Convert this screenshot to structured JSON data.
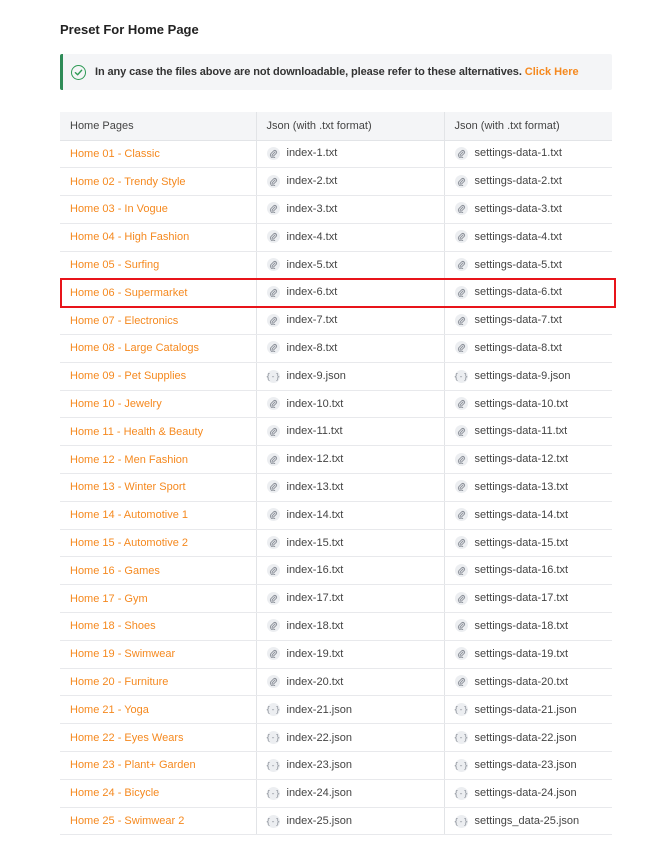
{
  "page": {
    "heading": "Preset For Home Page"
  },
  "callout": {
    "message": "In any case the files above are not downloadable, please refer to these alternatives.",
    "link_label": "Click Here",
    "accent_color": "#2e8b57",
    "link_color": "#f5891f"
  },
  "table": {
    "headers": [
      "Home Pages",
      "Json (with .txt format)",
      "Json (with .txt format)"
    ],
    "highlighted_row": 5,
    "rows": [
      {
        "name": "Home 01 - Classic",
        "index": "index-1.txt",
        "settings": "settings-data-1.txt",
        "icon": "paperclip-icon"
      },
      {
        "name": "Home 02 - Trendy Style",
        "index": "index-2.txt",
        "settings": "settings-data-2.txt",
        "icon": "paperclip-icon"
      },
      {
        "name": "Home 03 - In Vogue",
        "index": "index-3.txt",
        "settings": "settings-data-3.txt",
        "icon": "paperclip-icon"
      },
      {
        "name": "Home 04 - High Fashion",
        "index": "index-4.txt",
        "settings": "settings-data-4.txt",
        "icon": "paperclip-icon"
      },
      {
        "name": "Home 05 - Surfing",
        "index": "index-5.txt",
        "settings": "settings-data-5.txt",
        "icon": "paperclip-icon"
      },
      {
        "name": "Home 06 - Supermarket",
        "index": "index-6.txt",
        "settings": "settings-data-6.txt",
        "icon": "paperclip-icon"
      },
      {
        "name": "Home 07 - Electronics",
        "index": "index-7.txt",
        "settings": "settings-data-7.txt",
        "icon": "paperclip-icon"
      },
      {
        "name": "Home 08 - Large Catalogs",
        "index": "index-8.txt",
        "settings": "settings-data-8.txt",
        "icon": "paperclip-icon"
      },
      {
        "name": "Home 09 - Pet Supplies",
        "index": "index-9.json",
        "settings": "settings-data-9.json",
        "icon": "json-braces-icon"
      },
      {
        "name": "Home 10 - Jewelry",
        "index": "index-10.txt",
        "settings": "settings-data-10.txt",
        "icon": "paperclip-icon"
      },
      {
        "name": "Home 11 - Health & Beauty",
        "index": "index-11.txt",
        "settings": "settings-data-11.txt",
        "icon": "paperclip-icon"
      },
      {
        "name": "Home 12 - Men Fashion",
        "index": "index-12.txt",
        "settings": "settings-data-12.txt",
        "icon": "paperclip-icon"
      },
      {
        "name": "Home 13 - Winter Sport",
        "index": "index-13.txt",
        "settings": "settings-data-13.txt",
        "icon": "paperclip-icon"
      },
      {
        "name": "Home 14 - Automotive 1",
        "index": "index-14.txt",
        "settings": "settings-data-14.txt",
        "icon": "paperclip-icon"
      },
      {
        "name": "Home 15 - Automotive 2",
        "index": "index-15.txt",
        "settings": "settings-data-15.txt",
        "icon": "paperclip-icon"
      },
      {
        "name": "Home 16 - Games",
        "index": "index-16.txt",
        "settings": "settings-data-16.txt",
        "icon": "paperclip-icon"
      },
      {
        "name": "Home 17 - Gym",
        "index": "index-17.txt",
        "settings": "settings-data-17.txt",
        "icon": "paperclip-icon"
      },
      {
        "name": "Home 18 - Shoes",
        "index": "index-18.txt",
        "settings": "settings-data-18.txt",
        "icon": "paperclip-icon"
      },
      {
        "name": "Home 19 - Swimwear",
        "index": "index-19.txt",
        "settings": "settings-data-19.txt",
        "icon": "paperclip-icon"
      },
      {
        "name": "Home 20 - Furniture",
        "index": "index-20.txt",
        "settings": "settings-data-20.txt",
        "icon": "paperclip-icon"
      },
      {
        "name": "Home 21 - Yoga",
        "index": "index-21.json",
        "settings": "settings-data-21.json",
        "icon": "json-braces-icon"
      },
      {
        "name": "Home 22 - Eyes Wears",
        "index": "index-22.json",
        "settings": "settings-data-22.json",
        "icon": "json-braces-icon"
      },
      {
        "name": "Home 23 - Plant+ Garden",
        "index": "index-23.json",
        "settings": "settings-data-23.json",
        "icon": "json-braces-icon"
      },
      {
        "name": "Home 24 - Bicycle",
        "index": "index-24.json",
        "settings": "settings-data-24.json",
        "icon": "json-braces-icon"
      },
      {
        "name": "Home 25 - Swimwear 2",
        "index": "index-25.json",
        "settings": "settings_data-25.json",
        "icon": "json-braces-icon"
      }
    ]
  },
  "colors": {
    "link": "#f5891f",
    "highlight_border": "#e8141a",
    "header_bg": "#f4f5f7"
  }
}
